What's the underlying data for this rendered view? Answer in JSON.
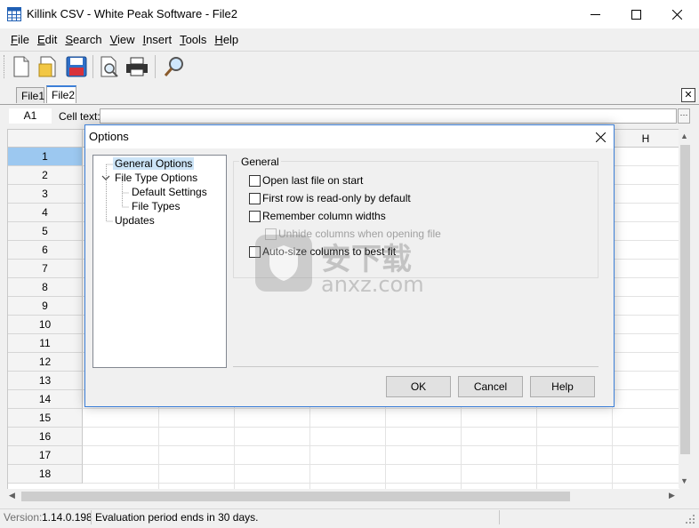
{
  "window": {
    "title": "Killink CSV - White Peak Software - File2"
  },
  "menu": [
    {
      "label": "File",
      "key": "F",
      "rest": "ile"
    },
    {
      "label": "Edit",
      "key": "E",
      "rest": "dit"
    },
    {
      "label": "Search",
      "key": "S",
      "rest": "earch"
    },
    {
      "label": "View",
      "key": "V",
      "rest": "iew"
    },
    {
      "label": "Insert",
      "key": "I",
      "rest": "nsert"
    },
    {
      "label": "Tools",
      "key": "T",
      "rest": "ools"
    },
    {
      "label": "Help",
      "key": "H",
      "rest": "elp"
    }
  ],
  "toolbar": {
    "buttons": [
      "new-file-icon",
      "open-file-icon",
      "save-file-icon",
      "print-preview-icon",
      "print-icon",
      "find-icon"
    ]
  },
  "tabs": [
    {
      "label": "File1",
      "active": false
    },
    {
      "label": "File2",
      "active": true
    }
  ],
  "cellbar": {
    "ref": "A1",
    "label": "Cell text:",
    "value": ""
  },
  "grid": {
    "column_visible": "H",
    "rows": [
      "1",
      "2",
      "3",
      "4",
      "5",
      "6",
      "7",
      "8",
      "9",
      "10",
      "11",
      "12",
      "13",
      "14",
      "15",
      "16",
      "17",
      "18"
    ],
    "selected_row": "1"
  },
  "status": {
    "version_label": "Version:",
    "version": "1.14.0.198",
    "message": "Evaluation period ends in 30 days."
  },
  "dialog": {
    "title": "Options",
    "tree": [
      {
        "label": "General Options",
        "selected": true
      },
      {
        "label": "File Type Options",
        "expanded": true
      },
      {
        "label": "Default Settings"
      },
      {
        "label": "File Types"
      },
      {
        "label": "Updates"
      }
    ],
    "group_title": "General",
    "options": [
      {
        "label": "Open last file on start",
        "checked": false,
        "enabled": true
      },
      {
        "label": "First row is read-only by default",
        "checked": false,
        "enabled": true
      },
      {
        "label": "Remember column widths",
        "checked": false,
        "enabled": true
      },
      {
        "label": "Unhide columns when opening file",
        "checked": false,
        "enabled": false
      },
      {
        "label": "Auto-size columns to best fit",
        "checked": false,
        "enabled": true
      }
    ],
    "buttons": {
      "ok": "OK",
      "cancel": "Cancel",
      "help": "Help"
    }
  },
  "watermark": {
    "text_cn": "安下载",
    "text_en": "anxz.com"
  },
  "colors": {
    "accent": "#3c7fd8",
    "selected_row": "#9cc8f0",
    "tree_selection": "#cce4f7"
  }
}
